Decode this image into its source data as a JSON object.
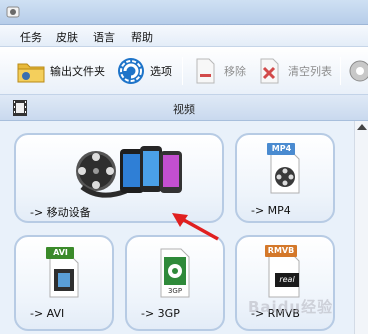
{
  "menu": [
    "任务",
    "皮肤",
    "语言",
    "帮助"
  ],
  "toolbar": {
    "output_folder": "输出文件夹",
    "options": "选项",
    "remove": "移除",
    "clear_list": "清空列表"
  },
  "tab": {
    "label": "视频"
  },
  "cards": {
    "mobile": "-> 移动设备",
    "mp4": "-> MP4",
    "avi": "-> AVI",
    "3gp": "-> 3GP",
    "rmvb": "-> RMVB"
  },
  "badges": {
    "mp4": "MP4",
    "avi": "AVI",
    "3gp": "3GP",
    "rmvb": "RMVB",
    "real": "real"
  },
  "watermark": "Baidu经验",
  "colors": {
    "accent_blue": "#1e74c9",
    "annotation_arrow": "#e02020",
    "mp4_badge": "#4a8bd0",
    "avi_badge": "#3a8a2a",
    "rmvb_badge": "#d4782a"
  }
}
